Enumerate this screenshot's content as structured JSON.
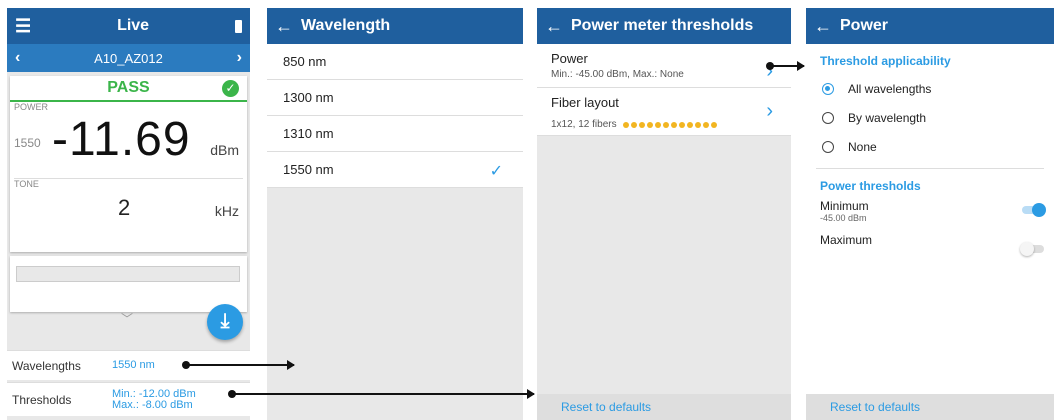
{
  "live": {
    "title": "Live",
    "menu_icon": "hamburger-icon",
    "battery_icon": "battery-icon",
    "device_name": "A10_AZ012",
    "status": "PASS",
    "power_label": "POWER",
    "wavelength_value": "1550",
    "power_value": "-11.69",
    "power_unit": "dBm",
    "tone_label": "TONE",
    "tone_value": "2",
    "tone_unit": "kHz",
    "wavelengths_key": "Wavelengths",
    "wavelengths_value": "1550 nm",
    "thresholds_key": "Thresholds",
    "thresholds_min": "Min.: -12.00 dBm",
    "thresholds_max": "Max.: -8.00 dBm"
  },
  "wavelength": {
    "title": "Wavelength",
    "items": [
      {
        "label": "850 nm"
      },
      {
        "label": "1300 nm"
      },
      {
        "label": "1310 nm"
      },
      {
        "label": "1550 nm",
        "selected": true
      }
    ]
  },
  "thresholds": {
    "title": "Power meter thresholds",
    "power_title": "Power",
    "power_sub": "Min.: -45.00 dBm, Max.: None",
    "fiber_title": "Fiber layout",
    "fiber_sub": "1x12, 12 fibers",
    "fiber_dot_count": 12,
    "reset": "Reset to defaults"
  },
  "power": {
    "title": "Power",
    "applicability_title": "Threshold applicability",
    "options": [
      {
        "label": "All wavelengths",
        "selected": true
      },
      {
        "label": "By wavelength",
        "selected": false
      },
      {
        "label": "None",
        "selected": false
      }
    ],
    "thresholds_title": "Power thresholds",
    "minimum_label": "Minimum",
    "minimum_value": "-45.00 dBm",
    "minimum_enabled": true,
    "maximum_label": "Maximum",
    "maximum_enabled": false,
    "reset": "Reset to defaults"
  },
  "colors": {
    "appbar": "#1f5f9e",
    "accent": "#2b9be3",
    "pass": "#3bb54a",
    "fiber_dot": "#f2b521"
  }
}
